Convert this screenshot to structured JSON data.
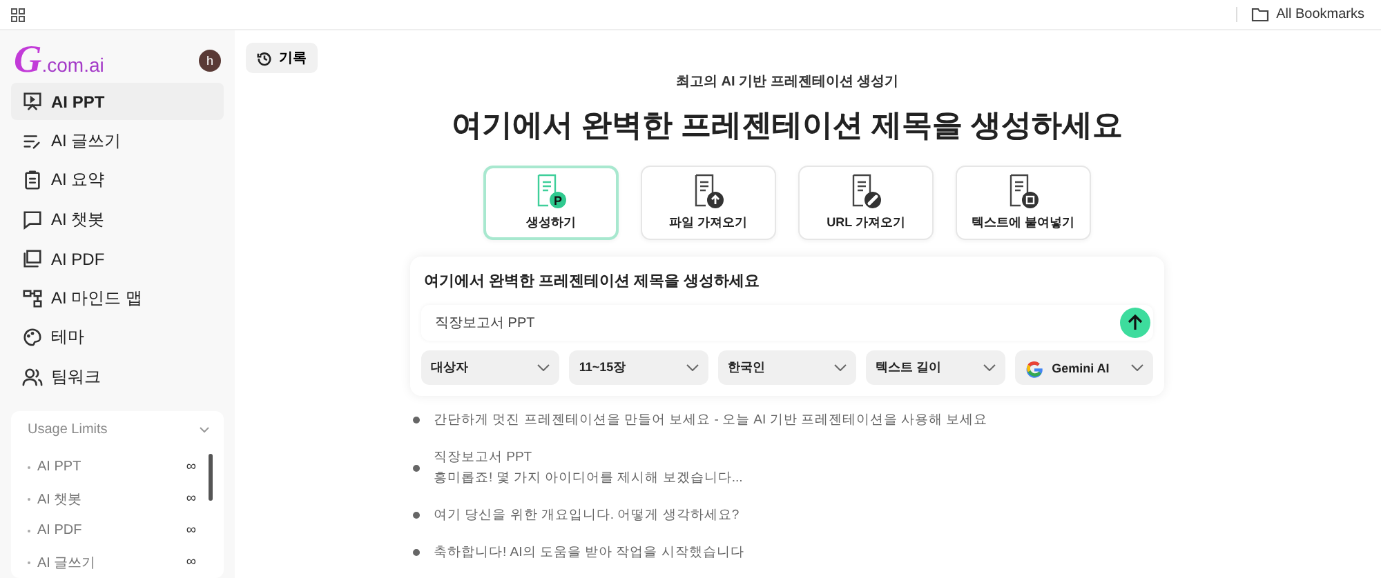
{
  "topbar": {
    "bookmarks": "All Bookmarks"
  },
  "sidebar": {
    "logo_letter": "G",
    "logo_text": ".com.ai",
    "avatar": "h",
    "items": [
      {
        "label": "AI PPT",
        "selected": true
      },
      {
        "label": "AI 글쓰기",
        "selected": false
      },
      {
        "label": "AI 요약",
        "selected": false
      },
      {
        "label": "AI 챗봇",
        "selected": false
      },
      {
        "label": "AI PDF",
        "selected": false
      },
      {
        "label": "AI 마인드 맵",
        "selected": false
      },
      {
        "label": "테마",
        "selected": false
      },
      {
        "label": "팀워크",
        "selected": false
      }
    ],
    "usage": {
      "title": "Usage Limits",
      "expanded": true,
      "rows": [
        {
          "label": "AI PPT",
          "value": "∞"
        },
        {
          "label": "AI 챗봇",
          "value": "∞"
        },
        {
          "label": "AI PDF",
          "value": "∞"
        },
        {
          "label": "AI 글쓰기",
          "value": "∞"
        }
      ]
    }
  },
  "history_button": "기록",
  "subtitle": "최고의 AI 기반 프레젠테이션 생성기",
  "heading": "여기에서 완벽한 프레젠테이션 제목을 생성하세요",
  "modes": [
    {
      "label": "생성하기",
      "badge": "P",
      "selected": true
    },
    {
      "label": "파일 가져오기",
      "selected": false
    },
    {
      "label": "URL 가져오기",
      "selected": false
    },
    {
      "label": "텍스트에 붙여넣기",
      "selected": false
    }
  ],
  "panel": {
    "title": "여기에서 완벽한 프레젠테이션 제목을 생성하세요",
    "input_value": "직장보고서 PPT",
    "dropdowns": [
      {
        "label": "대상자"
      },
      {
        "label": "11~15장"
      },
      {
        "label": "한국인"
      },
      {
        "label": "텍스트 길이"
      },
      {
        "label": "Gemini AI",
        "kind": "model"
      }
    ]
  },
  "suggestions": [
    {
      "lines": [
        "간단하게 멋진 프레젠테이션을 만들어 보세요 - 오늘 AI 기반 프레젠테이션을 사용해 보세요"
      ]
    },
    {
      "lines": [
        "직장보고서 PPT",
        "흥미롭죠! 몇 가지 아이디어를 제시해 보겠습니다..."
      ]
    },
    {
      "lines": [
        "여기 당신을 위한 개요입니다. 어떻게 생각하세요?"
      ]
    },
    {
      "lines": [
        "축하합니다! AI의 도움을 받아 작업을 시작했습니다"
      ]
    }
  ]
}
